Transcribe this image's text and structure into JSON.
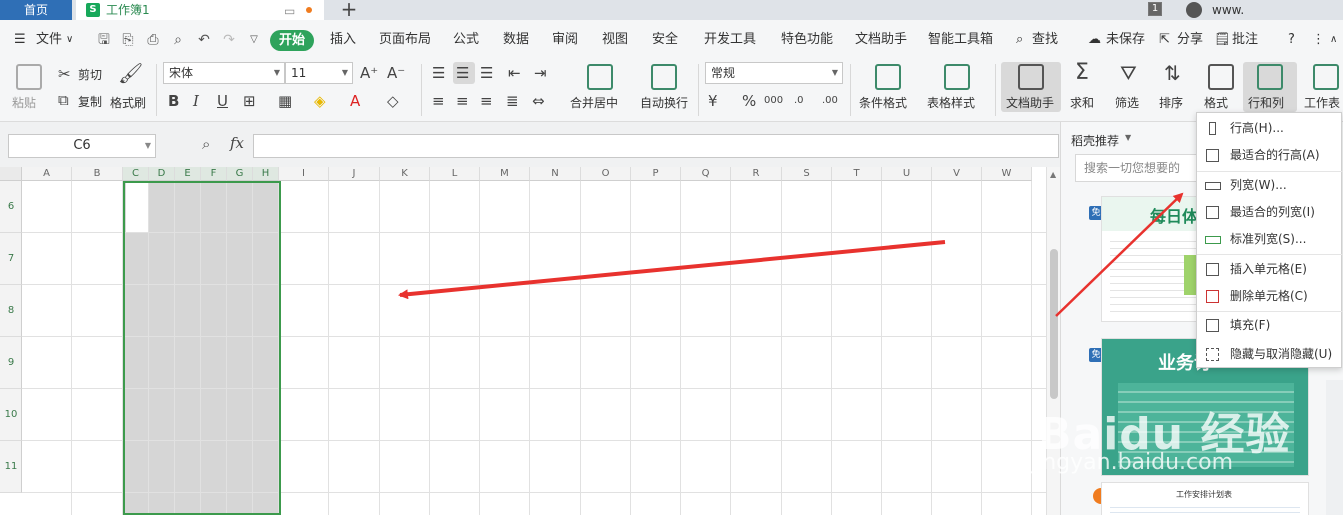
{
  "titlebar": {
    "home_tab": "首页",
    "doc_icon": "S",
    "doc_tab": "工作簿1",
    "notification_count": "1",
    "user": "www."
  },
  "menubar": {
    "file": "文件",
    "start": "开始",
    "tabs": [
      "插入",
      "页面布局",
      "公式",
      "数据",
      "审阅",
      "视图",
      "安全",
      "开发工具",
      "特色功能",
      "文档助手",
      "智能工具箱"
    ],
    "search": "查找",
    "unsaved": "未保存",
    "share": "分享",
    "comment": "批注"
  },
  "ribbon": {
    "paste": "粘贴",
    "cut": "剪切",
    "copy": "复制",
    "format_painter": "格式刷",
    "font_name": "宋体",
    "font_size": "11",
    "merge_center": "合并居中",
    "wrap_text": "自动换行",
    "number_format": "常规",
    "conditional_format": "条件格式",
    "table_style": "表格样式",
    "doc_assistant": "文档助手",
    "sum": "求和",
    "filter": "筛选",
    "sort": "排序",
    "format": "格式",
    "row_col": "行和列",
    "worksheet": "工作表"
  },
  "formula_bar": {
    "cell_ref": "C6",
    "fx": "fx",
    "formula": ""
  },
  "grid": {
    "columns": [
      "A",
      "B",
      "C",
      "D",
      "E",
      "F",
      "G",
      "H",
      "I",
      "J",
      "K",
      "L",
      "M",
      "N",
      "O",
      "P",
      "Q",
      "R",
      "S",
      "T",
      "U",
      "V",
      "W"
    ],
    "selected_columns": [
      "C",
      "D",
      "E",
      "F",
      "G",
      "H"
    ],
    "rows": [
      "6",
      "7",
      "8",
      "9",
      "10",
      "11"
    ]
  },
  "rightpane": {
    "title": "稻壳推荐",
    "search_placeholder": "搜索一切您想要的",
    "free_badge": "免",
    "card1_title": "每日体温记",
    "card2_title": "业务订",
    "card3_title": "工作安排计划表"
  },
  "context_menu": {
    "items": [
      {
        "label": "行高(H)...",
        "icon": "row-height-icon"
      },
      {
        "label": "最适合的行高(A)",
        "icon": "best-row-height-icon"
      },
      {
        "label": "列宽(W)...",
        "icon": "column-width-icon"
      },
      {
        "label": "最适合的列宽(I)",
        "icon": "best-column-width-icon"
      },
      {
        "label": "标准列宽(S)...",
        "icon": "standard-width-icon"
      },
      {
        "label": "插入单元格(E)",
        "icon": "insert-cells-icon"
      },
      {
        "label": "删除单元格(C)",
        "icon": "delete-cells-icon"
      },
      {
        "label": "填充(F)",
        "icon": "fill-icon"
      },
      {
        "label": "隐藏与取消隐藏(U)",
        "icon": "hide-unhide-icon"
      }
    ]
  },
  "watermark": {
    "brand": "Baidu 经验",
    "url": "jingyan.baidu.com"
  },
  "colors": {
    "accent_green": "#2ea35c",
    "selection_border": "#3c9a4c",
    "home_tab_blue": "#2f6fb6",
    "arrow_red": "#e8322e"
  }
}
